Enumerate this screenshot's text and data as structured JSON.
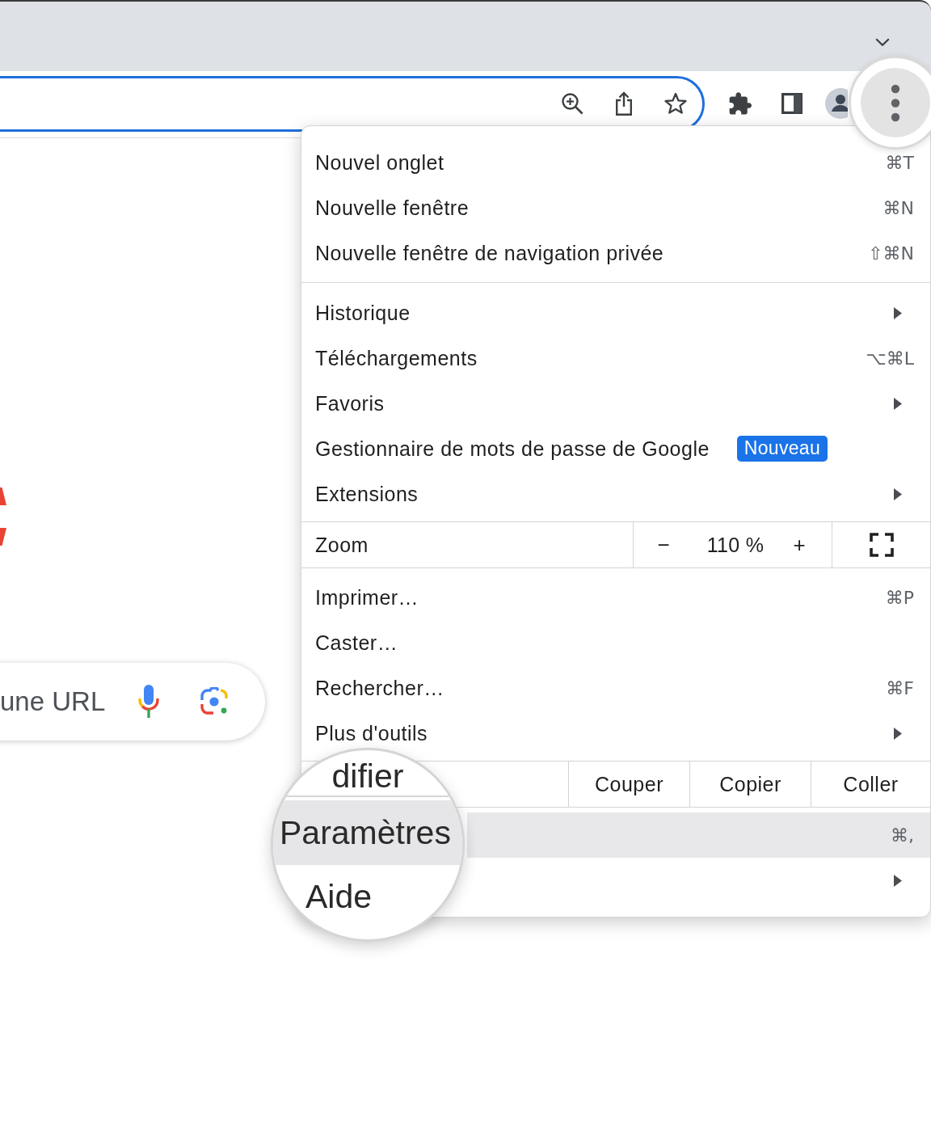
{
  "search": {
    "placeholder": "une URL"
  },
  "menu": {
    "rows": [
      {
        "kind": "item",
        "label": "Nouvel onglet",
        "shortcut": "⌘T",
        "submenu": false,
        "highlighted": false
      },
      {
        "kind": "item",
        "label": "Nouvelle fenêtre",
        "shortcut": "⌘N",
        "submenu": false,
        "highlighted": false
      },
      {
        "kind": "item",
        "label": "Nouvelle fenêtre de navigation privée",
        "shortcut": "⇧⌘N",
        "submenu": false,
        "highlighted": false
      },
      {
        "kind": "separator"
      },
      {
        "kind": "item",
        "label": "Historique",
        "submenu": true,
        "highlighted": false
      },
      {
        "kind": "item",
        "label": "Téléchargements",
        "shortcut": "⌥⌘L",
        "submenu": false,
        "highlighted": false
      },
      {
        "kind": "item",
        "label": "Favoris",
        "submenu": true,
        "highlighted": false
      },
      {
        "kind": "item",
        "label": "Gestionnaire de mots de passe de Google",
        "badge": "Nouveau",
        "submenu": false,
        "highlighted": false
      },
      {
        "kind": "item",
        "label": "Extensions",
        "submenu": true,
        "highlighted": false
      },
      {
        "kind": "zoom",
        "label": "Zoom",
        "decrease": "−",
        "value": "110 %",
        "increase": "+"
      },
      {
        "kind": "item",
        "label": "Imprimer…",
        "shortcut": "⌘P",
        "submenu": false,
        "highlighted": false
      },
      {
        "kind": "item",
        "label": "Caster…",
        "submenu": false,
        "highlighted": false
      },
      {
        "kind": "item",
        "label": "Rechercher…",
        "shortcut": "⌘F",
        "submenu": false,
        "highlighted": false
      },
      {
        "kind": "item",
        "label": "Plus d'outils",
        "submenu": true,
        "highlighted": false
      },
      {
        "kind": "edit",
        "buttons": [
          "Couper",
          "Copier",
          "Coller"
        ]
      },
      {
        "kind": "item",
        "shortcut": "⌘,",
        "submenu": false,
        "highlighted": true
      },
      {
        "kind": "item",
        "submenu": true,
        "highlighted": false
      }
    ]
  },
  "magnifier": {
    "items": [
      {
        "label": "difier",
        "highlighted": false
      },
      {
        "label": "Paramètres",
        "highlighted": true
      },
      {
        "label": "Aide",
        "highlighted": false
      }
    ]
  }
}
